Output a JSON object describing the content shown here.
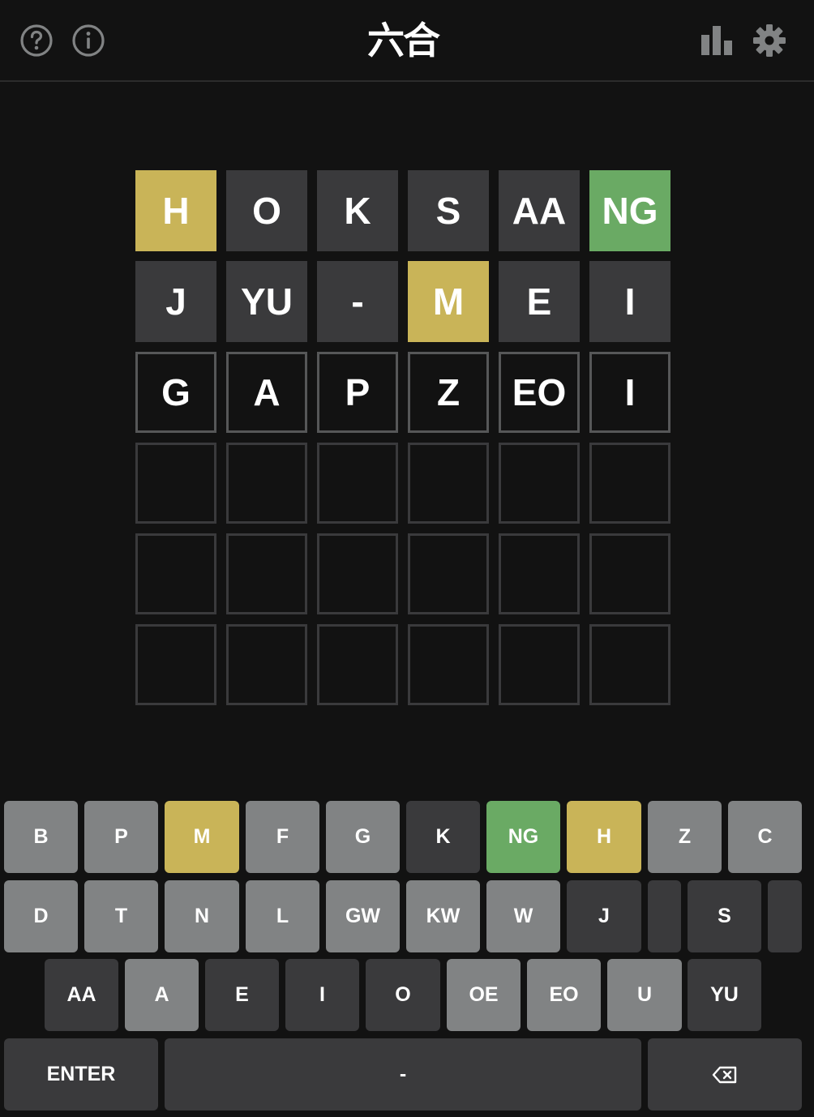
{
  "header": {
    "title": "六合",
    "icons": [
      "help-icon",
      "info-icon",
      "stats-icon",
      "settings-icon"
    ]
  },
  "colors": {
    "background": "#121212",
    "absent": "#3a3a3c",
    "present": "#c9b458",
    "correct": "#6aaa64",
    "unused_key": "#818384",
    "empty_border": "#3a3a3c",
    "typed_border": "#565758"
  },
  "board": {
    "rows": [
      [
        {
          "letter": "H",
          "state": "present"
        },
        {
          "letter": "O",
          "state": "absent"
        },
        {
          "letter": "K",
          "state": "absent"
        },
        {
          "letter": "S",
          "state": "absent"
        },
        {
          "letter": "AA",
          "state": "absent"
        },
        {
          "letter": "NG",
          "state": "correct"
        }
      ],
      [
        {
          "letter": "J",
          "state": "absent"
        },
        {
          "letter": "YU",
          "state": "absent"
        },
        {
          "letter": "-",
          "state": "absent"
        },
        {
          "letter": "M",
          "state": "present"
        },
        {
          "letter": "E",
          "state": "absent"
        },
        {
          "letter": "I",
          "state": "absent"
        }
      ],
      [
        {
          "letter": "G",
          "state": "typed"
        },
        {
          "letter": "A",
          "state": "typed"
        },
        {
          "letter": "P",
          "state": "typed"
        },
        {
          "letter": "Z",
          "state": "typed"
        },
        {
          "letter": "EO",
          "state": "typed"
        },
        {
          "letter": "I",
          "state": "typed"
        }
      ],
      [
        {
          "letter": "",
          "state": "empty"
        },
        {
          "letter": "",
          "state": "empty"
        },
        {
          "letter": "",
          "state": "empty"
        },
        {
          "letter": "",
          "state": "empty"
        },
        {
          "letter": "",
          "state": "empty"
        },
        {
          "letter": "",
          "state": "empty"
        }
      ],
      [
        {
          "letter": "",
          "state": "empty"
        },
        {
          "letter": "",
          "state": "empty"
        },
        {
          "letter": "",
          "state": "empty"
        },
        {
          "letter": "",
          "state": "empty"
        },
        {
          "letter": "",
          "state": "empty"
        },
        {
          "letter": "",
          "state": "empty"
        }
      ],
      [
        {
          "letter": "",
          "state": "empty"
        },
        {
          "letter": "",
          "state": "empty"
        },
        {
          "letter": "",
          "state": "empty"
        },
        {
          "letter": "",
          "state": "empty"
        },
        {
          "letter": "",
          "state": "empty"
        },
        {
          "letter": "",
          "state": "empty"
        }
      ]
    ]
  },
  "keyboard": {
    "row1": [
      {
        "label": "B",
        "state": "unused"
      },
      {
        "label": "P",
        "state": "unused"
      },
      {
        "label": "M",
        "state": "present"
      },
      {
        "label": "F",
        "state": "unused"
      },
      {
        "label": "G",
        "state": "unused"
      },
      {
        "label": "K",
        "state": "absent"
      },
      {
        "label": "NG",
        "state": "correct"
      },
      {
        "label": "H",
        "state": "present"
      },
      {
        "label": "Z",
        "state": "unused"
      },
      {
        "label": "C",
        "state": "unused"
      }
    ],
    "row2": [
      {
        "label": "D",
        "state": "unused"
      },
      {
        "label": "T",
        "state": "unused"
      },
      {
        "label": "N",
        "state": "unused"
      },
      {
        "label": "L",
        "state": "unused"
      },
      {
        "label": "GW",
        "state": "unused"
      },
      {
        "label": "KW",
        "state": "unused"
      },
      {
        "label": "W",
        "state": "unused"
      },
      {
        "label": "J",
        "state": "absent"
      },
      {
        "label": "",
        "state": "absent"
      },
      {
        "label": "S",
        "state": "absent"
      },
      {
        "label": "",
        "state": "absent"
      }
    ],
    "row3": [
      {
        "label": "AA",
        "state": "absent"
      },
      {
        "label": "A",
        "state": "unused"
      },
      {
        "label": "E",
        "state": "absent"
      },
      {
        "label": "I",
        "state": "absent"
      },
      {
        "label": "O",
        "state": "absent"
      },
      {
        "label": "OE",
        "state": "unused"
      },
      {
        "label": "EO",
        "state": "unused"
      },
      {
        "label": "U",
        "state": "unused"
      },
      {
        "label": "YU",
        "state": "absent"
      }
    ],
    "row4": [
      {
        "label": "ENTER",
        "state": "wide"
      },
      {
        "label": "-",
        "state": "wide"
      },
      {
        "label": "",
        "state": "wide",
        "icon": "backspace-icon"
      }
    ]
  }
}
